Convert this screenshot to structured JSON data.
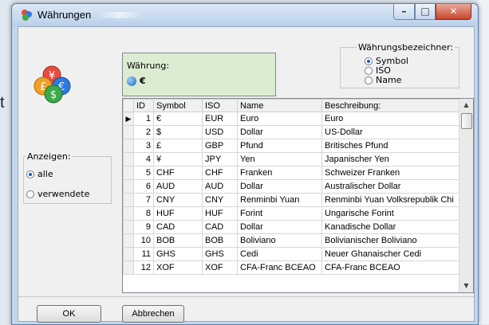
{
  "window": {
    "title": "Währungen",
    "minimize": "–",
    "maximize": "□",
    "close": "✕"
  },
  "background": {
    "letter": "t"
  },
  "current": {
    "label": "Währung:",
    "value": "€"
  },
  "bezeichner": {
    "legend": "Währungsbezeichner:",
    "options": [
      "Symbol",
      "ISO",
      "Name"
    ],
    "selected": "Symbol"
  },
  "anzeigen": {
    "legend": "Anzeigen:",
    "options": [
      "alle",
      "verwendete"
    ],
    "selected": "alle"
  },
  "table": {
    "columns": [
      "ID",
      "Symbol",
      "ISO",
      "Name",
      "Beschreibung:"
    ],
    "rows": [
      {
        "id": "1",
        "symbol": "€",
        "iso": "EUR",
        "name": "Euro",
        "desc": "Euro"
      },
      {
        "id": "2",
        "symbol": "$",
        "iso": "USD",
        "name": "Dollar",
        "desc": "US-Dollar"
      },
      {
        "id": "3",
        "symbol": "£",
        "iso": "GBP",
        "name": "Pfund",
        "desc": "Britisches Pfund"
      },
      {
        "id": "4",
        "symbol": "¥",
        "iso": "JPY",
        "name": "Yen",
        "desc": "Japanischer Yen"
      },
      {
        "id": "5",
        "symbol": "CHF",
        "iso": "CHF",
        "name": "Franken",
        "desc": "Schweizer Franken"
      },
      {
        "id": "6",
        "symbol": "AUD",
        "iso": "AUD",
        "name": "Dollar",
        "desc": "Australischer Dollar"
      },
      {
        "id": "7",
        "symbol": "CNY",
        "iso": "CNY",
        "name": "Renminbi Yuan",
        "desc": "Renminbi Yuan Volksrepublik Chi"
      },
      {
        "id": "8",
        "symbol": "HUF",
        "iso": "HUF",
        "name": "Forint",
        "desc": "Ungarische Forint"
      },
      {
        "id": "9",
        "symbol": "CAD",
        "iso": "CAD",
        "name": "Dollar",
        "desc": "Kanadische Dollar"
      },
      {
        "id": "10",
        "symbol": "BOB",
        "iso": "BOB",
        "name": "Boliviano",
        "desc": "Bolivianischer Boliviano"
      },
      {
        "id": "11",
        "symbol": "GHS",
        "iso": "GHS",
        "name": "Cedi",
        "desc": "Neuer Ghanaischer Cedi"
      },
      {
        "id": "12",
        "symbol": "XOF",
        "iso": "XOF",
        "name": "CFA-Franc BCEAO",
        "desc": "CFA-Franc BCEAO"
      }
    ],
    "current_row": "▶",
    "scroll_up": "▲",
    "scroll_down": "▼"
  },
  "buttons": {
    "ok": "OK",
    "cancel": "Abbrechen"
  },
  "icons": {
    "app": "currency-coins-icon",
    "globe": "globe-icon"
  }
}
